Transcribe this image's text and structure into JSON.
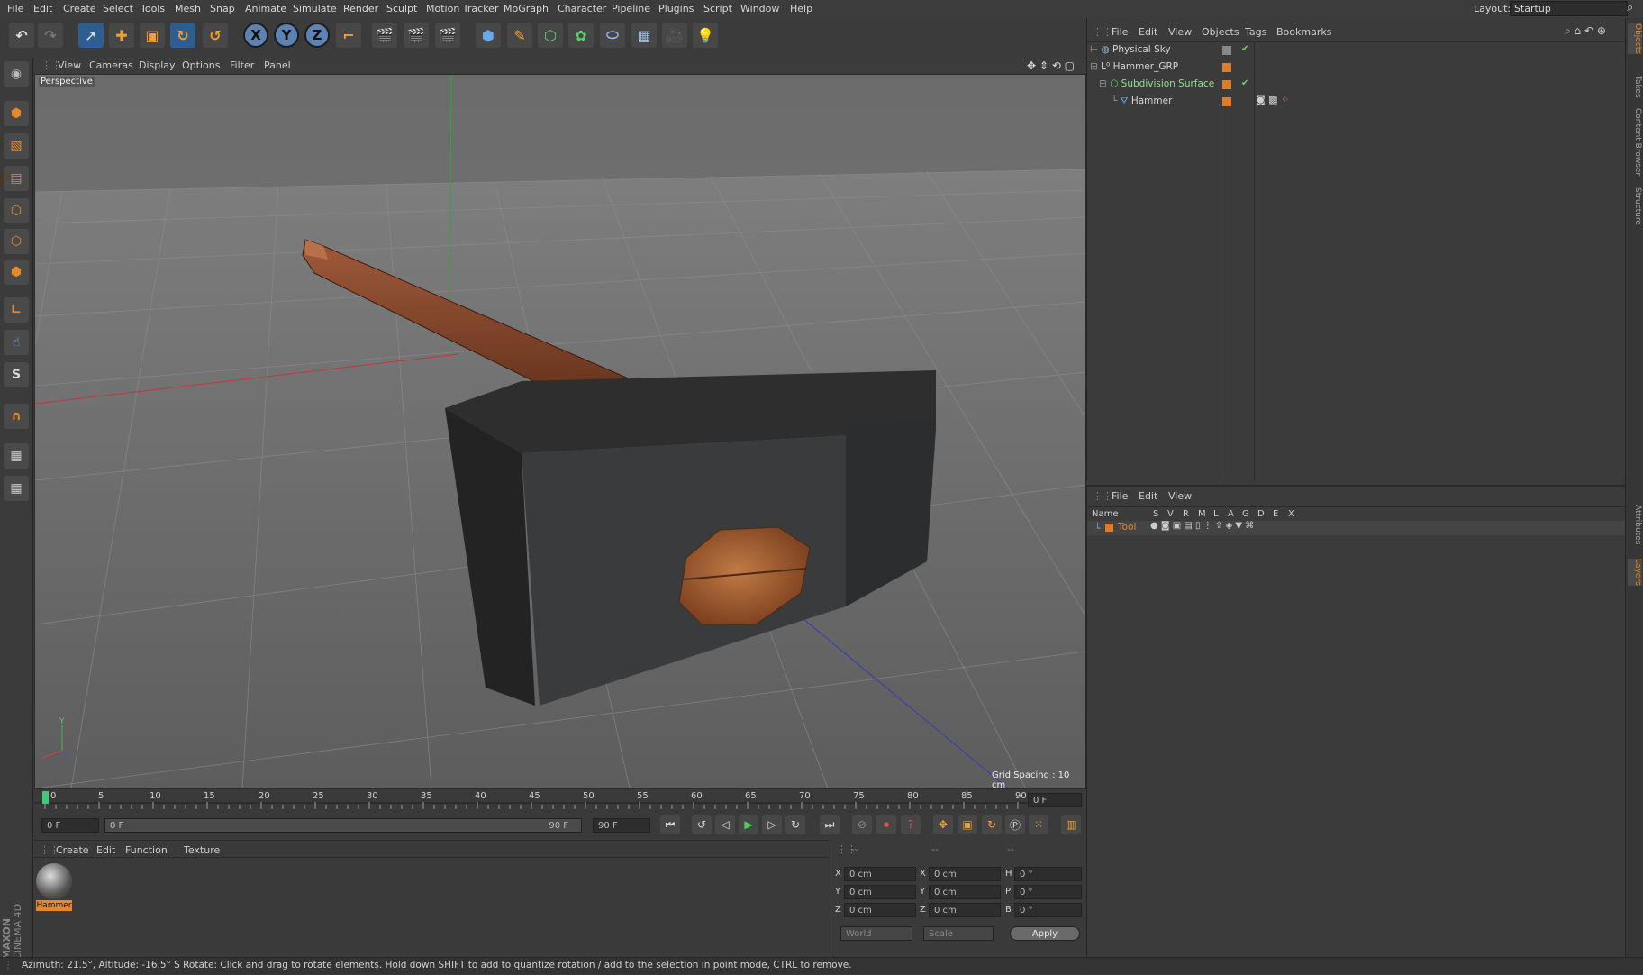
{
  "menubar": {
    "items": [
      "File",
      "Edit",
      "Create",
      "Select",
      "Tools",
      "Mesh",
      "Snap",
      "Animate",
      "Simulate",
      "Render",
      "Sculpt",
      "Motion Tracker",
      "MoGraph",
      "Character",
      "Pipeline",
      "Plugins",
      "Script",
      "Window",
      "Help"
    ],
    "layout_label": "Layout:",
    "layout_value": "Startup"
  },
  "toolbar": {
    "axis_x": "X",
    "axis_y": "Y",
    "axis_z": "Z"
  },
  "lefttools": {
    "snap_label": "S"
  },
  "viewport": {
    "menu": [
      "View",
      "Cameras",
      "Display",
      "Options",
      "Filter",
      "Panel"
    ],
    "camera_label": "Perspective",
    "grid_spacing": "Grid Spacing : 10 cm",
    "axis_y_label": "Y"
  },
  "timeline": {
    "ticks": [
      "0",
      "5",
      "10",
      "15",
      "20",
      "25",
      "30",
      "35",
      "40",
      "45",
      "50",
      "55",
      "60",
      "65",
      "70",
      "75",
      "80",
      "85",
      "90"
    ],
    "current_frame": "0 F",
    "start_field": "0 F",
    "range_start": "0 F",
    "range_end": "90 F",
    "end_field": "90 F"
  },
  "material_panel": {
    "menu": [
      "Create",
      "Edit",
      "Function",
      "Texture"
    ],
    "material_name": "Hammer"
  },
  "coord_panel": {
    "headers": [
      "--",
      "--",
      "--"
    ],
    "rows": [
      {
        "a": "X",
        "av": "0 cm",
        "b": "X",
        "bv": "0 cm",
        "c": "H",
        "cv": "0 °"
      },
      {
        "a": "Y",
        "av": "0 cm",
        "b": "Y",
        "bv": "0 cm",
        "c": "P",
        "cv": "0 °"
      },
      {
        "a": "Z",
        "av": "0 cm",
        "b": "Z",
        "bv": "0 cm",
        "c": "B",
        "cv": "0 °"
      }
    ],
    "world_label": "World",
    "scale_label": "Scale",
    "apply_label": "Apply"
  },
  "object_manager": {
    "menu": [
      "File",
      "Edit",
      "View",
      "Objects",
      "Tags",
      "Bookmarks"
    ],
    "objects": [
      {
        "name": "Physical Sky"
      },
      {
        "name": "Hammer_GRP"
      },
      {
        "name": "Subdivision Surface"
      },
      {
        "name": "Hammer"
      }
    ]
  },
  "layer_manager": {
    "menu": [
      "File",
      "Edit",
      "View"
    ],
    "columns": [
      "Name",
      "S",
      "V",
      "R",
      "M",
      "L",
      "A",
      "G",
      "D",
      "E",
      "X"
    ],
    "layers": [
      {
        "name": "Tool",
        "color": "#e07b2a"
      }
    ]
  },
  "sidetabs": [
    "Objects",
    "Takes",
    "Content Browser",
    "Structure",
    "Attributes",
    "Layers"
  ],
  "brand": {
    "maxon": "MAXON",
    "product": "CINEMA 4D"
  },
  "statusbar": {
    "text": "Azimuth: 21.5°, Altitude: -16.5°  S     Rotate: Click and drag to rotate elements. Hold down SHIFT to add to quantize rotation / add to the selection in point mode, CTRL to remove."
  },
  "colors": {
    "accent": "#e58a2c",
    "selection_blue": "#2e5d8f",
    "bg": "#3a3a3a"
  }
}
